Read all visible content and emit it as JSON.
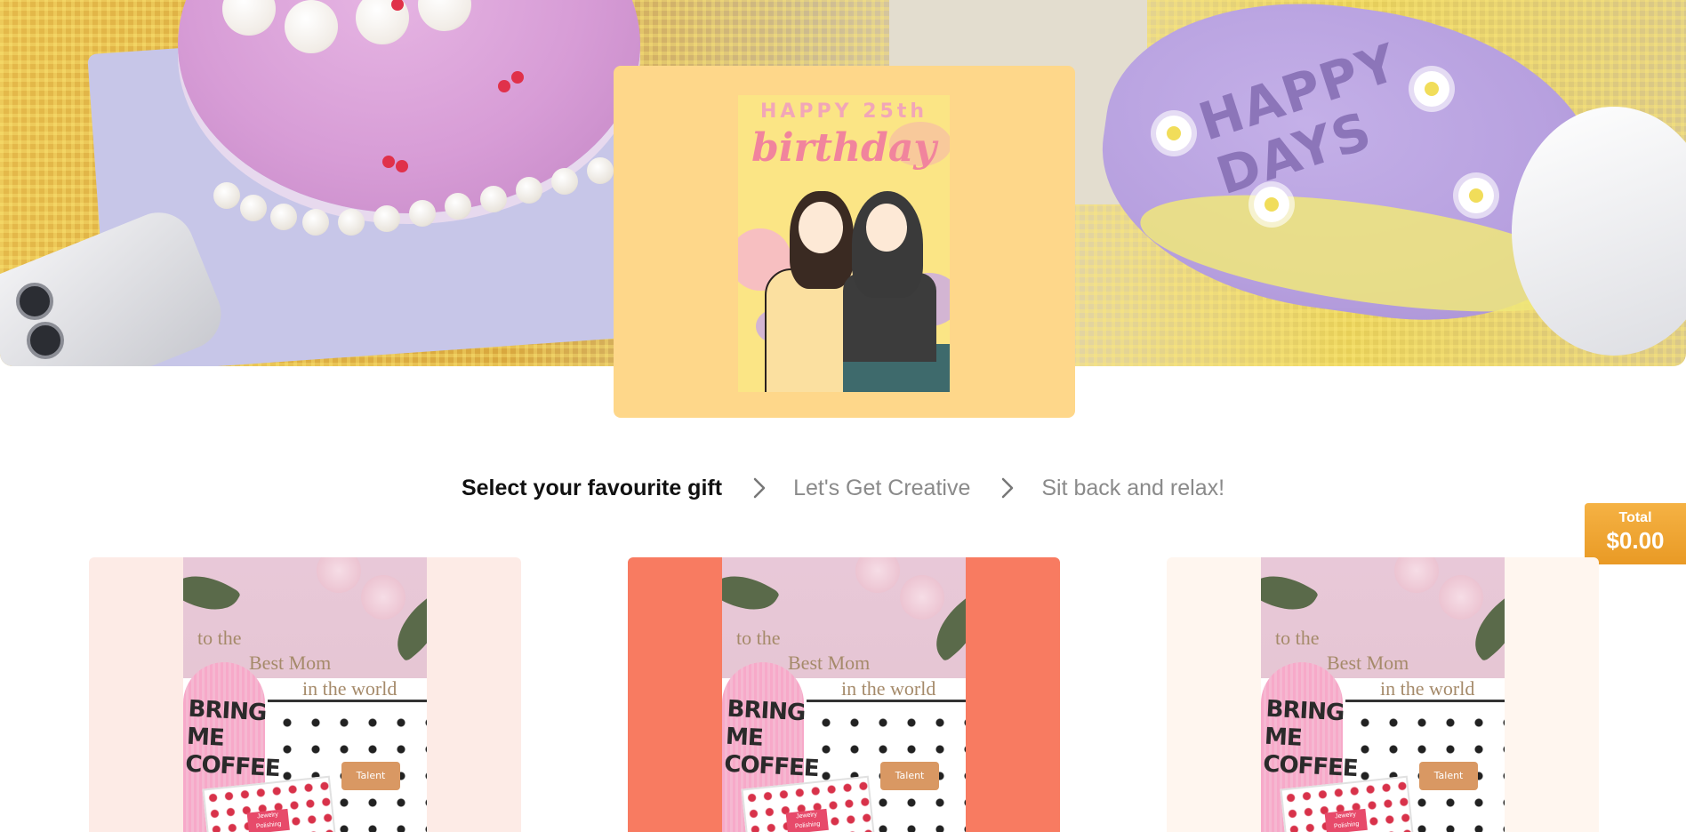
{
  "hero": {
    "cake_text": "HAPPY\nDAYS"
  },
  "card_preview": {
    "happy_text": "HAPPY 25th",
    "birthday_text": "birthday"
  },
  "steps": [
    {
      "label": "Select your favourite gift",
      "active": true
    },
    {
      "label": "Let's Get Creative",
      "active": false
    },
    {
      "label": "Sit back and relax!",
      "active": false
    }
  ],
  "total": {
    "label": "Total",
    "amount": "$0.00"
  },
  "products": [
    {
      "background": "#fdebe6",
      "photo_line1": "to the",
      "photo_line2": "Best Mom",
      "photo_line3": "in the world",
      "sock_text": "BRING\nME\nCOFFEE",
      "tag_text": "Talent",
      "box_label": "Jewelry Polishing"
    },
    {
      "background": "#f87b61",
      "photo_line1": "to the",
      "photo_line2": "Best Mom",
      "photo_line3": "in the world",
      "sock_text": "BRING\nME\nCOFFEE",
      "tag_text": "Talent",
      "box_label": "Jewelry Polishing"
    },
    {
      "background": "#fff6ef",
      "photo_line1": "to the",
      "photo_line2": "Best Mom",
      "photo_line3": "in the world",
      "sock_text": "BRING\nME\nCOFFEE",
      "tag_text": "Talent",
      "box_label": "Jewelry Polishing"
    }
  ],
  "colors": {
    "card_preview_bg": "#fed78a",
    "total_badge": "#f0a535",
    "active_step": "#111111",
    "inactive_step": "#8a8a8a"
  },
  "icons": {
    "step_separator": "chevron-right-icon"
  }
}
